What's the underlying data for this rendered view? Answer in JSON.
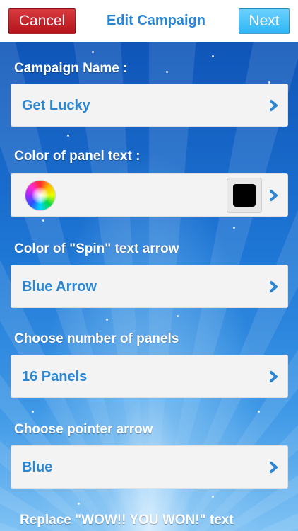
{
  "navbar": {
    "cancel_label": "Cancel",
    "title": "Edit Campaign",
    "next_label": "Next",
    "colors": {
      "cancel": "#c4252b",
      "next": "#46c1fb",
      "title": "#2a86d3"
    }
  },
  "form": {
    "campaign_name": {
      "label": "Campaign Name :",
      "value": "Get  Lucky"
    },
    "panel_text_color": {
      "label": "Color of panel text :",
      "swatch_color": "#000000",
      "picker_icon": "color-wheel-icon"
    },
    "spin_arrow_color": {
      "label": "Color of \"Spin\" text arrow",
      "value": "Blue Arrow"
    },
    "panel_count": {
      "label": "Choose number of panels",
      "value": "16 Panels"
    },
    "pointer_arrow": {
      "label": "Choose pointer arrow",
      "value": "Blue"
    },
    "replace_text": {
      "label": "Replace \"WOW!! YOU WON!\" text"
    }
  },
  "icons": {
    "disclosure": "chevron-right-icon"
  }
}
